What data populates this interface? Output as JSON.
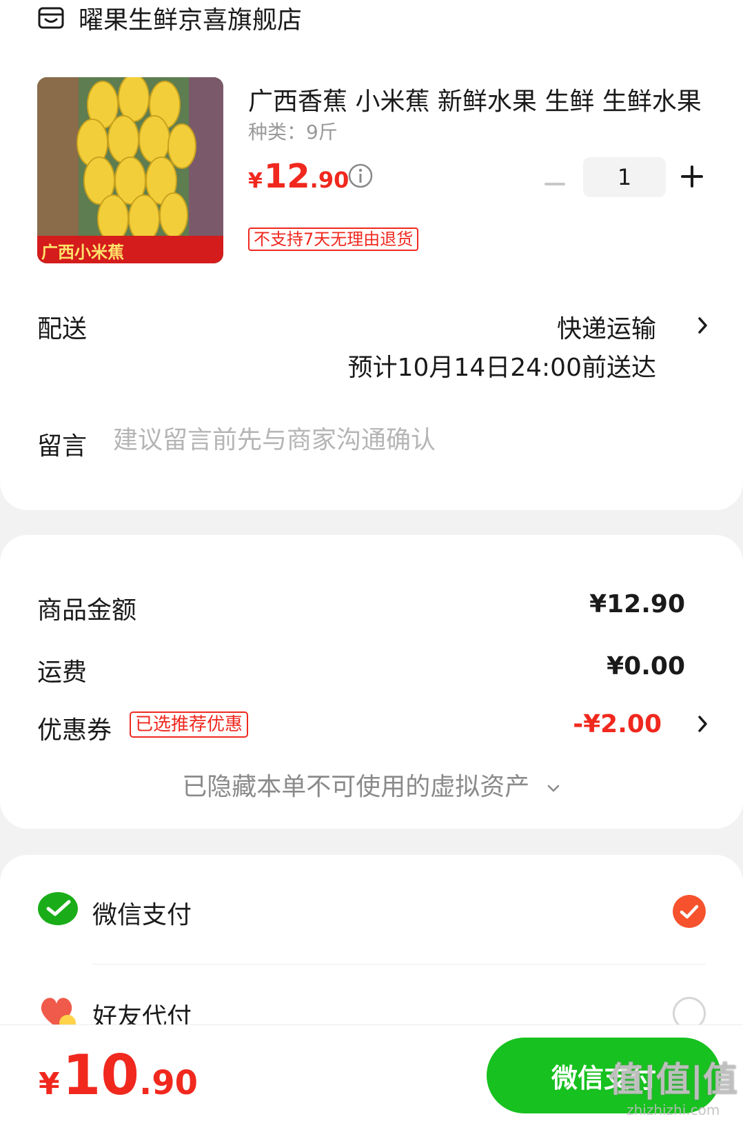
{
  "store": {
    "name": "曜果生鲜京喜旗舰店",
    "icon": "store-icon"
  },
  "product": {
    "title": "广西香蕉 小米蕉 新鲜水果 生鲜 生鲜水果",
    "spec": "种类：9斤",
    "thumb_label": "广西小米蕉",
    "price_symbol": "¥",
    "price_int": "12",
    "price_dec": ".90",
    "quantity": "1",
    "return_policy": "不支持7天无理由退货"
  },
  "delivery": {
    "label": "配送",
    "method": "快递运输",
    "eta": "预计10月14日24:00前送达"
  },
  "note": {
    "label": "留言",
    "placeholder": "建议留言前先与商家沟通确认"
  },
  "amounts": {
    "goods_label": "商品金额",
    "goods_value": "¥12.90",
    "shipping_label": "运费",
    "shipping_value": "¥0.00",
    "coupon_label": "优惠券",
    "coupon_tag": "已选推荐优惠",
    "coupon_value": "-¥2.00",
    "hidden_assets": "已隐藏本单不可使用的虚拟资产"
  },
  "payment": {
    "methods": [
      {
        "name": "微信支付",
        "selected": true,
        "icon": "wechat-pay-icon"
      },
      {
        "name": "好友代付",
        "selected": false,
        "icon": "friend-pay-icon"
      }
    ]
  },
  "footer": {
    "total_symbol": "¥",
    "total_int": "10",
    "total_dec": ".90",
    "pay_button": "微信支付",
    "watermark_main": "值|值|值",
    "watermark_sub": "zhizhizhi.com"
  },
  "colors": {
    "accent_red": "#f0281e",
    "wechat_green": "#17c11f",
    "selected_orange": "#f5522d"
  }
}
